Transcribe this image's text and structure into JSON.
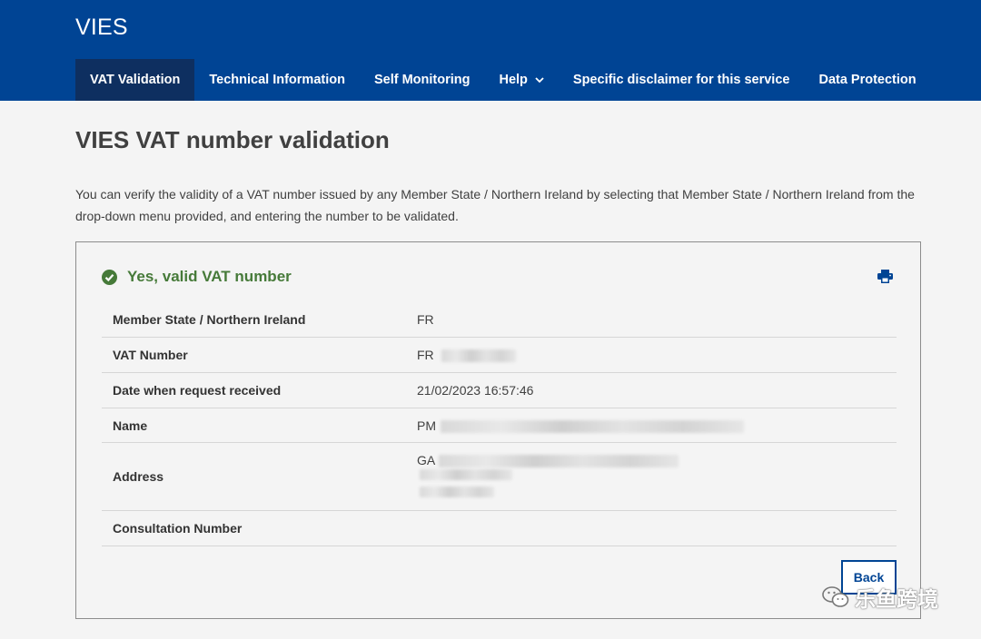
{
  "header": {
    "site_title": "VIES",
    "nav": [
      {
        "label": "VAT Validation",
        "active": true
      },
      {
        "label": "Technical Information"
      },
      {
        "label": "Self Monitoring"
      },
      {
        "label": "Help",
        "has_dropdown": true
      },
      {
        "label": "Specific disclaimer for this service"
      },
      {
        "label": "Data Protection"
      }
    ]
  },
  "main": {
    "page_title": "VIES VAT number validation",
    "intro": "You can verify the validity of a VAT number issued by any Member State / Northern Ireland by selecting that Member State / Northern Ireland from the drop-down menu provided, and entering the number to be validated."
  },
  "result": {
    "status_text": "Yes, valid VAT number",
    "rows": [
      {
        "label": "Member State / Northern Ireland",
        "value": "FR"
      },
      {
        "label": "VAT Number",
        "value": "FR"
      },
      {
        "label": "Date when request received",
        "value": "21/02/2023 16:57:46"
      },
      {
        "label": "Name",
        "value": "PM"
      },
      {
        "label": "Address",
        "value": "GA"
      },
      {
        "label": "Consultation Number",
        "value": ""
      }
    ],
    "back_label": "Back"
  },
  "watermark": {
    "text": "乐鱼跨境"
  },
  "colors": {
    "brand_blue": "#004494",
    "active_nav": "#0e2f60",
    "valid_green": "#467a39"
  }
}
